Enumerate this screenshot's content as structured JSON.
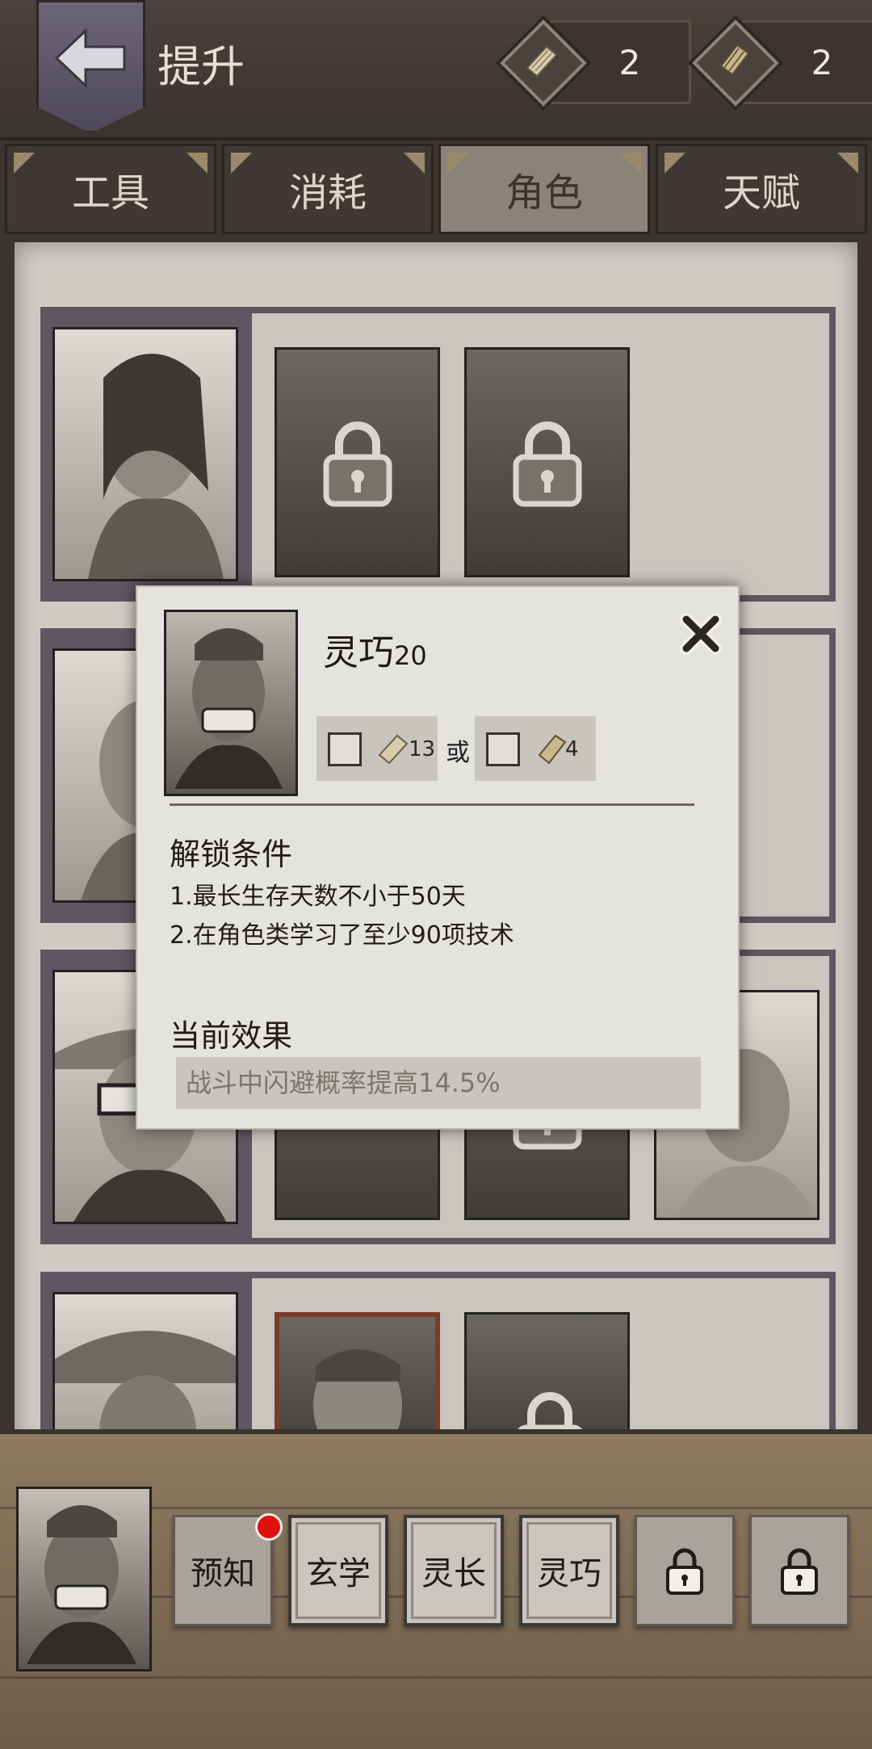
{
  "header": {
    "title": "提升",
    "resources": [
      {
        "icon": "scroll-icon",
        "count": "2"
      },
      {
        "icon": "book-icon",
        "count": "2"
      }
    ]
  },
  "tabs": [
    {
      "label": "工具",
      "active": false
    },
    {
      "label": "消耗",
      "active": false
    },
    {
      "label": "角色",
      "active": true
    },
    {
      "label": "天赋",
      "active": false
    }
  ],
  "modal": {
    "skill_name": "灵巧",
    "skill_level": "20",
    "cost_a": "13",
    "or_label": "或",
    "cost_b": "4",
    "unlock_heading": "解锁条件",
    "conditions": [
      "1.最长生存天数不小于50天",
      "2.在角色类学习了至少90项技术"
    ],
    "effect_heading": "当前效果",
    "effect_text": "战斗中闪避概率提高14.5%"
  },
  "skills": [
    {
      "label": "预知",
      "badge": true
    },
    {
      "label": "玄学"
    },
    {
      "label": "灵长"
    },
    {
      "label": "灵巧"
    },
    {
      "label": "",
      "locked": true
    },
    {
      "label": "",
      "locked": true
    }
  ],
  "colors": {
    "accent_red": "#e01010",
    "selected_frame": "#7a3c2a",
    "row_frame": "#5e5660"
  }
}
